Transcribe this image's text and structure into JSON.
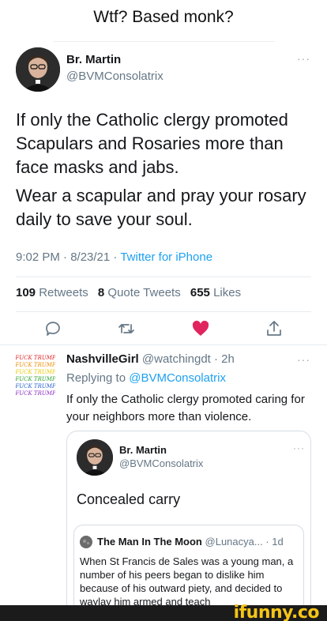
{
  "caption": "Wtf? Based monk?",
  "tweet": {
    "name": "Br. Martin",
    "handle": "@BVMConsolatrix",
    "more": "···",
    "paragraph1": "If only the Catholic clergy promoted Scapulars and Rosaries more than face masks and jabs.",
    "paragraph2": "Wear a scapular and pray your rosary daily to save your soul.",
    "time_date": "9:02 PM · 8/23/21 · ",
    "source": "Twitter for iPhone",
    "retweets_count": "109",
    "retweets_label": "Retweets",
    "quotes_count": "8",
    "quotes_label": "Quote Tweets",
    "likes_count": "655",
    "likes_label": "Likes",
    "actions": [
      "reply-icon",
      "retweet-icon",
      "heart-icon",
      "share-icon"
    ],
    "colors": {
      "heart": "#e0245e",
      "link": "#1da1f2",
      "muted": "#657786"
    }
  },
  "reply": {
    "name": "NashvilleGirl",
    "handle_time": "@watchingdt · 2h",
    "more": "···",
    "replying_prefix": "Replying to ",
    "replying_to": "@BVMConsolatrix",
    "text": "If only the Catholic clergy promoted caring for your neighbors more than violence.",
    "avatar_text": [
      "FUCK TRUMP",
      "FUCK TRUMP",
      "FUCK TRUMP",
      "FUCK TRUMP",
      "FUCK TRUMP",
      "FUCK TRUMP"
    ]
  },
  "quoted": {
    "name": "Br. Martin",
    "handle": "@BVMConsolatrix",
    "more": "···",
    "text": "Concealed carry",
    "nested": {
      "name": "The Man In The Moon",
      "handle_time": "@Lunacya... · 1d",
      "text": "When St Francis de Sales was a young man, a number of his peers began to dislike him because of his outward piety, and decided to waylay him armed and teach"
    }
  },
  "watermark": "ifunny.co"
}
